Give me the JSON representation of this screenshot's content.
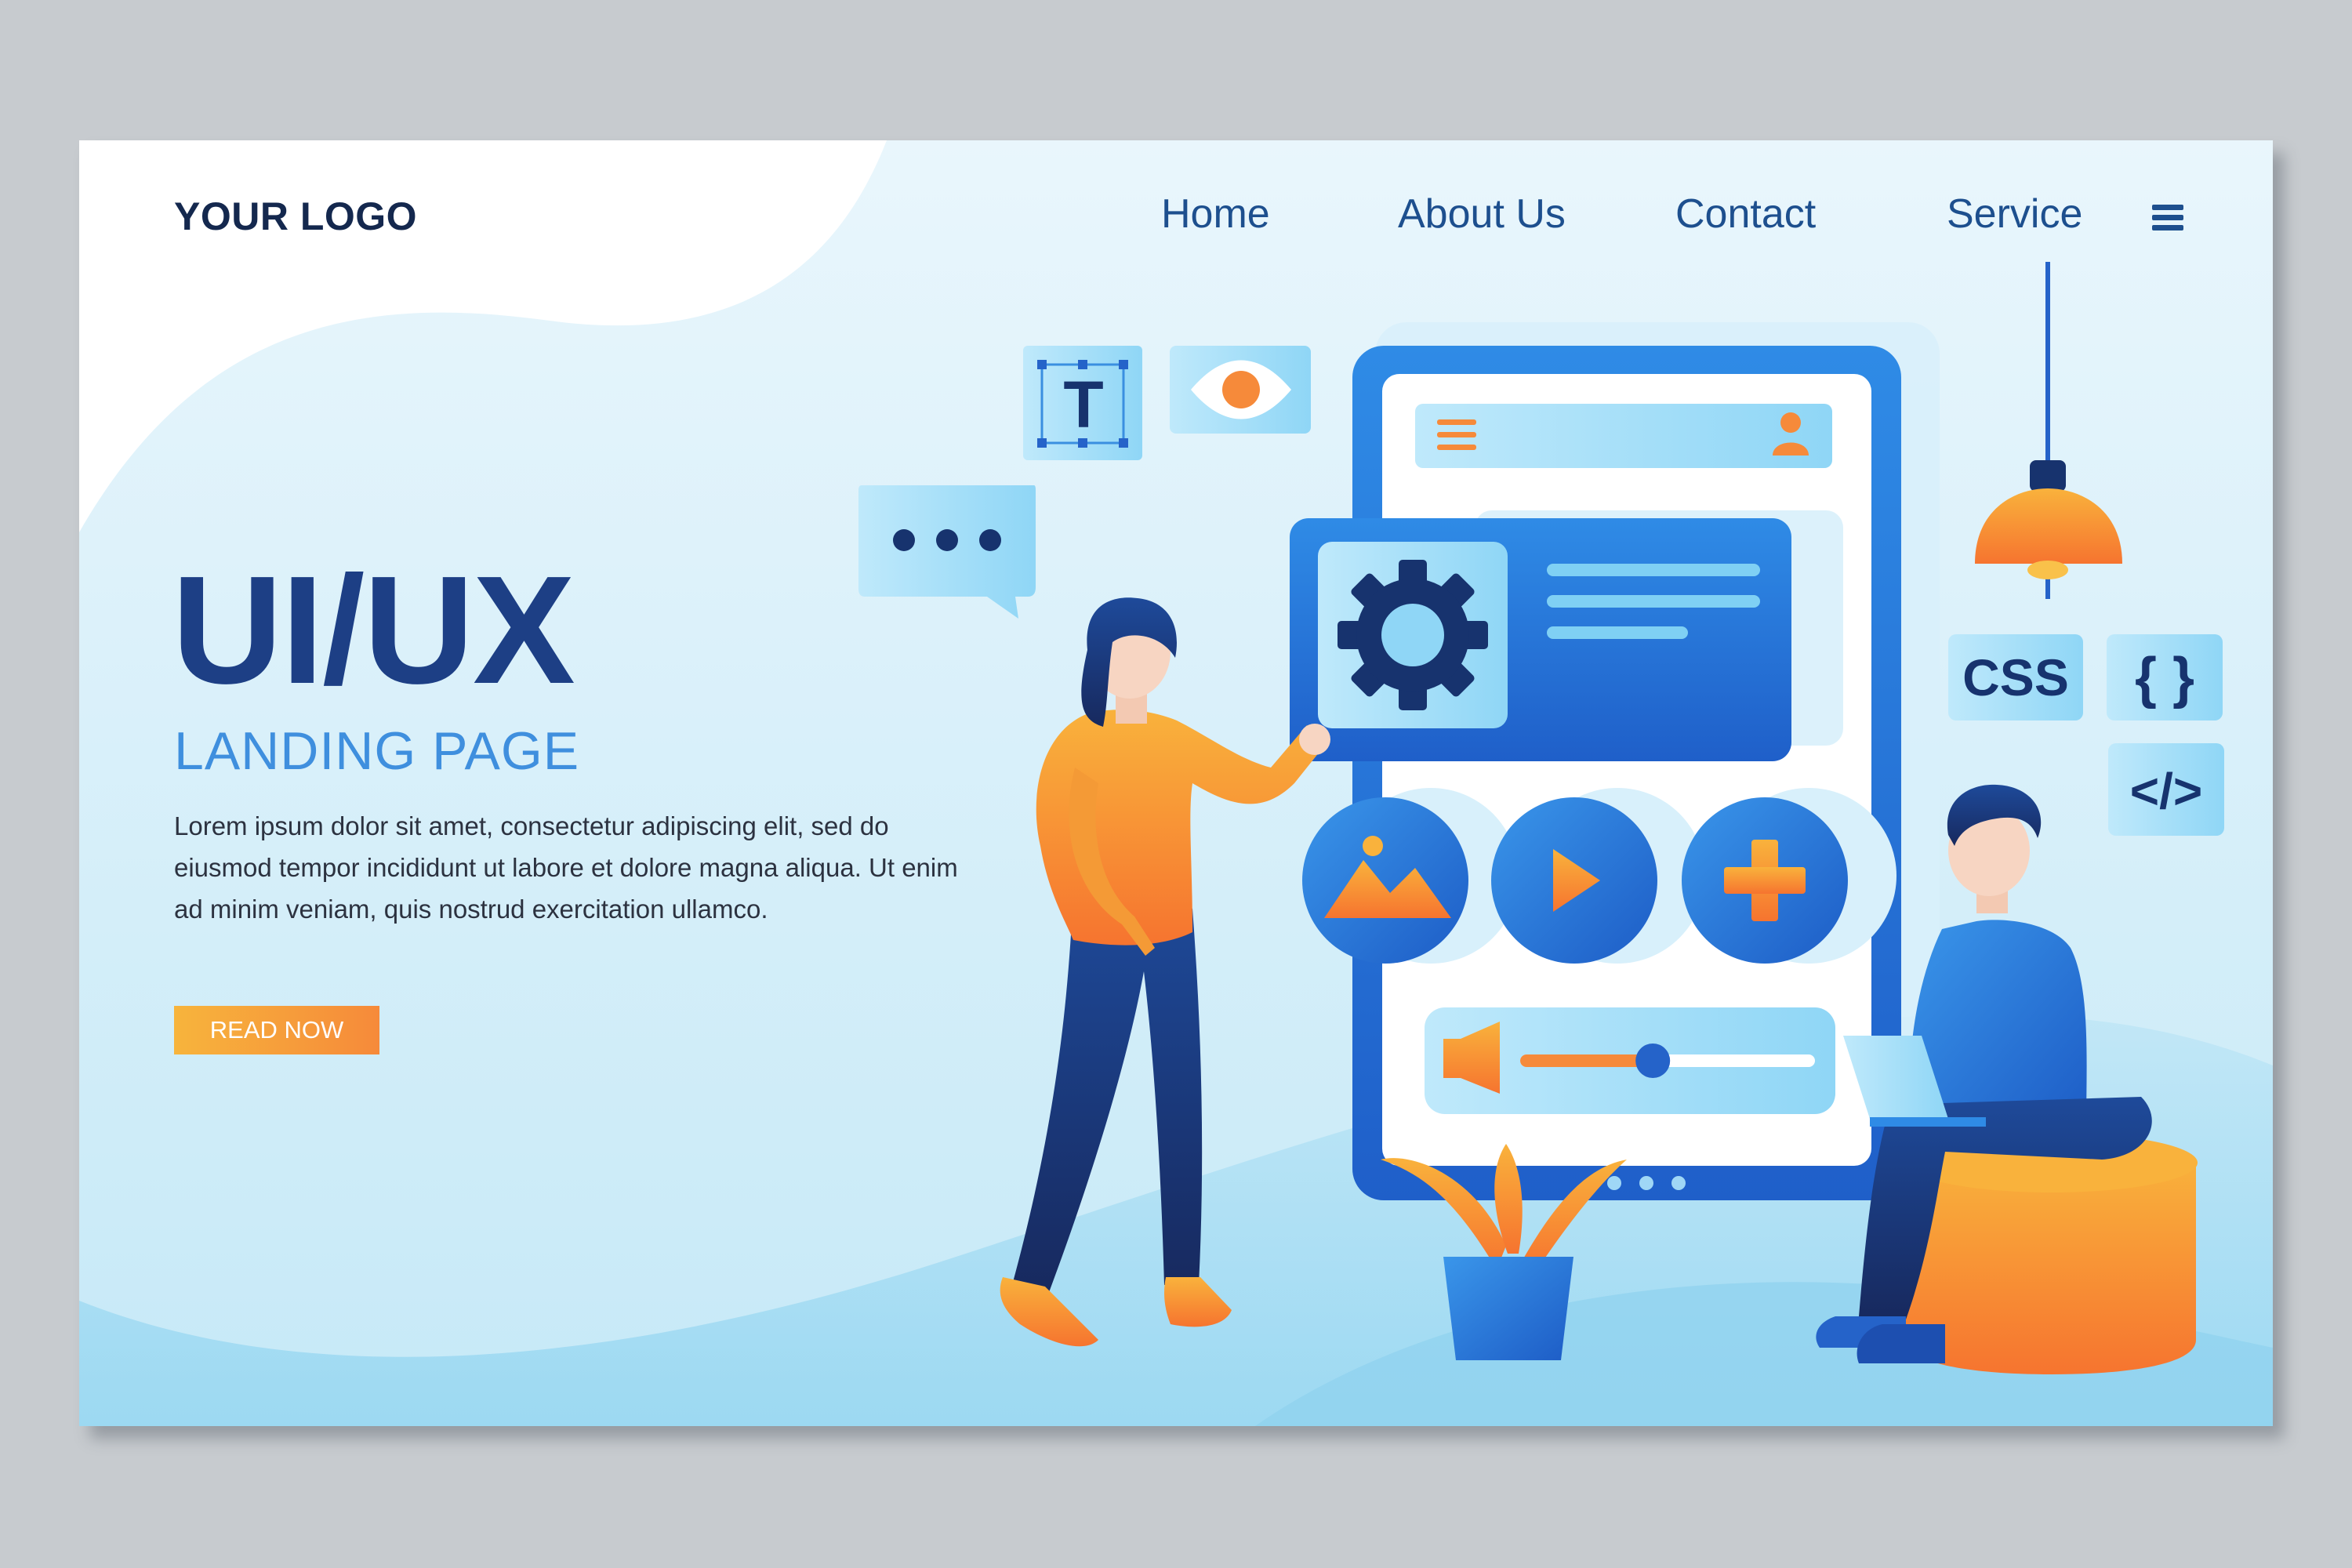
{
  "header": {
    "logo": "YOUR LOGO",
    "nav": [
      {
        "label": "Home"
      },
      {
        "label": "About Us"
      },
      {
        "label": "Contact"
      },
      {
        "label": "Service"
      }
    ]
  },
  "hero": {
    "title": "UI/UX",
    "subtitle": "LANDING PAGE",
    "body": "Lorem ipsum dolor sit amet, consectetur adipiscing elit, sed do eiusmod tempor incididunt ut labore et dolore magna aliqua. Ut enim ad minim veniam, quis nostrud exercitation ullamco.",
    "cta_label": "READ NOW"
  },
  "illustration": {
    "text_tool_glyph": "T",
    "css_tag": "CSS",
    "braces_tag": "{ }",
    "code_tag": "</>",
    "volume_level": 0.45,
    "icons": [
      "text-tool-icon",
      "eye-icon",
      "chat-bubble-icon",
      "gear-icon",
      "image-icon",
      "play-icon",
      "plus-icon",
      "volume-icon",
      "user-icon",
      "menu-icon",
      "lamp-icon",
      "plant-icon",
      "laptop-icon"
    ]
  },
  "colors": {
    "brand_dark": "#1d3f85",
    "brand_light": "#3f8fde",
    "accent_orange": "#f68a3a",
    "nav_text": "#1d4f8e"
  }
}
